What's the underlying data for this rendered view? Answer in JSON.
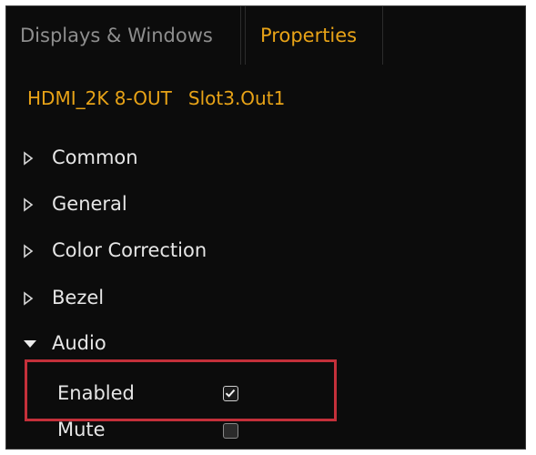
{
  "tabs": [
    {
      "label": "Displays & Windows",
      "active": false
    },
    {
      "label": "Properties",
      "active": true
    }
  ],
  "device": {
    "name": "HDMI_2K 8-OUT",
    "slot": "Slot3.Out1"
  },
  "groups": [
    {
      "label": "Common",
      "expanded": false
    },
    {
      "label": "General",
      "expanded": false
    },
    {
      "label": "Color Correction",
      "expanded": false
    },
    {
      "label": "Bezel",
      "expanded": false
    },
    {
      "label": "Audio",
      "expanded": true
    }
  ],
  "audio": {
    "enabled": {
      "label": "Enabled",
      "checked": true
    },
    "mute": {
      "label": "Mute",
      "checked": false
    }
  },
  "colors": {
    "accent": "#e8a317",
    "panel_bg": "#0c0c0c",
    "text": "#e6e6e6",
    "muted_text": "#8e8e8e",
    "highlight": "#c4303a"
  },
  "icons": {
    "collapsed": "triangle-right-icon",
    "expanded": "triangle-down-icon",
    "checked": "checkmark-icon"
  }
}
